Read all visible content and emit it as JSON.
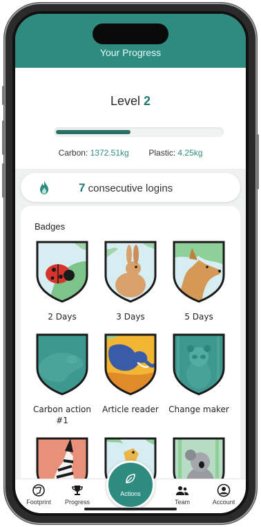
{
  "header": {
    "title": "Your Progress"
  },
  "level": {
    "label": "Level",
    "value": "2",
    "progress": 0.45
  },
  "stats": {
    "carbon_label": "Carbon:",
    "carbon_value": "1372.51kg",
    "plastic_label": "Plastic:",
    "plastic_value": "4.25kg"
  },
  "logins": {
    "count": "7",
    "label": "consecutive logins",
    "icon": "flame-icon"
  },
  "badges": {
    "title": "Badges",
    "items": [
      {
        "label": "2 Days",
        "animal": "ladybug",
        "earned": true
      },
      {
        "label": "3 Days",
        "animal": "rabbit",
        "earned": true
      },
      {
        "label": "5 Days",
        "animal": "fox",
        "earned": true
      },
      {
        "label": "Carbon action #1",
        "animal": "bear",
        "earned": false
      },
      {
        "label": "Article reader",
        "animal": "elephant",
        "earned": true
      },
      {
        "label": "Change maker",
        "animal": "panda",
        "earned": false
      },
      {
        "label": "",
        "animal": "zebra",
        "earned": true
      },
      {
        "label": "",
        "animal": "giraffe",
        "earned": true
      },
      {
        "label": "",
        "animal": "koala",
        "earned": true
      }
    ]
  },
  "nav": {
    "items": [
      {
        "label": "Footprint",
        "icon": "globe-icon"
      },
      {
        "label": "Progress",
        "icon": "trophy-icon"
      },
      {
        "label": "Actions",
        "icon": "leaf-icon"
      },
      {
        "label": "Team",
        "icon": "team-icon"
      },
      {
        "label": "Account",
        "icon": "account-icon"
      }
    ]
  },
  "colors": {
    "brand": "#2e8b80",
    "accent_text": "#1f7a71",
    "locked_badge": "#3d9990"
  }
}
